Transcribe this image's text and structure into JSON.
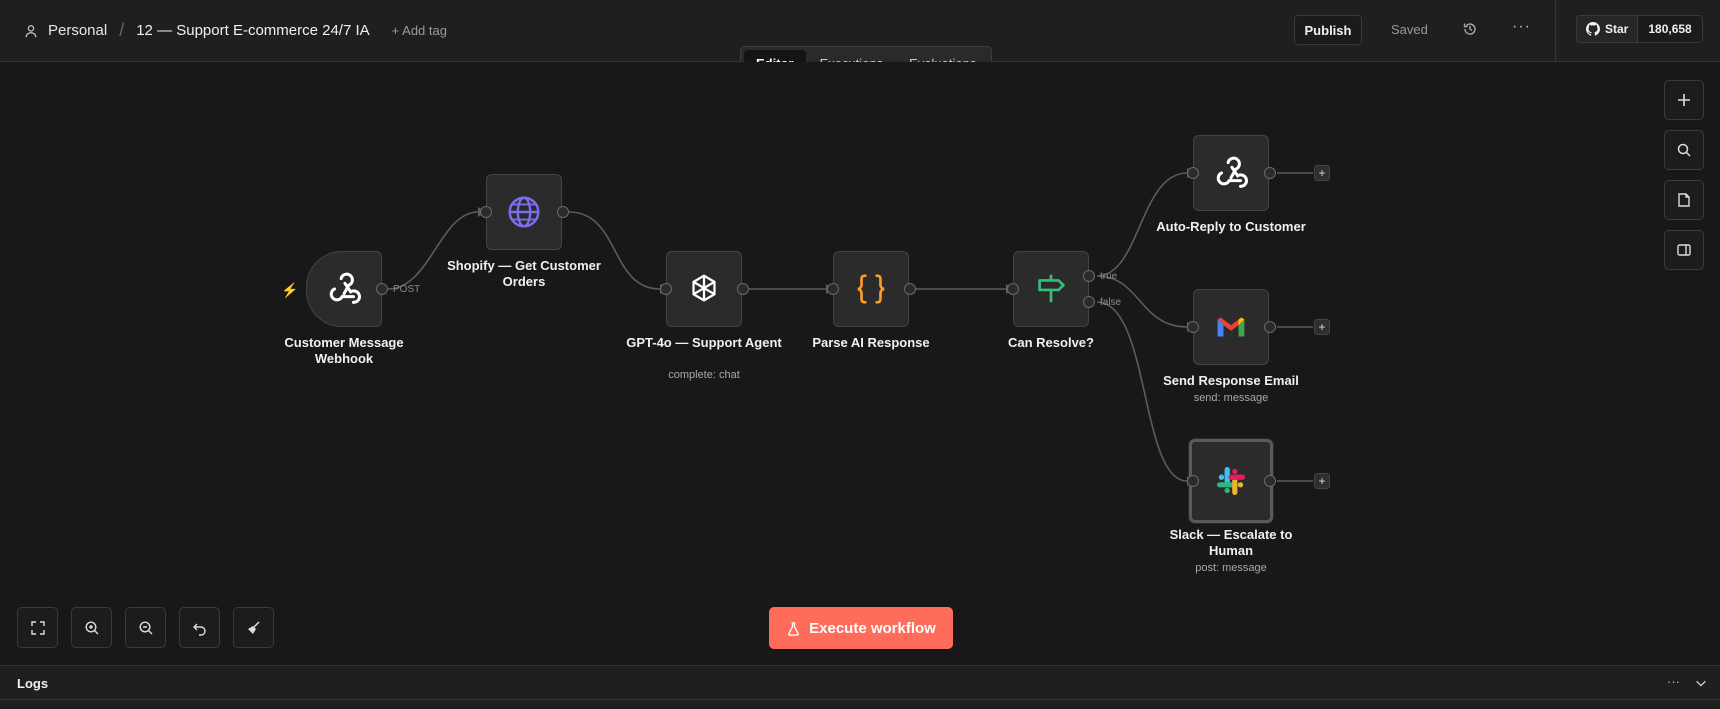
{
  "header": {
    "workspace": "Personal",
    "workflow_title": "12 — Support E-commerce 24/7 IA",
    "add_tag": "+ Add tag",
    "publish": "Publish",
    "status": "Saved",
    "github_star": "Star",
    "github_count": "180,658"
  },
  "tabs": [
    "Editor",
    "Executions",
    "Evaluations"
  ],
  "nodes": {
    "webhook": {
      "label": "Customer Message Webhook",
      "icon": "webhook-icon"
    },
    "shopify": {
      "label": "Shopify — Get Customer Orders",
      "icon": "globe-icon"
    },
    "gpt": {
      "label": "GPT-4o — Support Agent",
      "sub": "complete: chat",
      "icon": "openai-icon"
    },
    "parse": {
      "label": "Parse AI Response",
      "icon": "code-braces-icon"
    },
    "resolve": {
      "label": "Can Resolve?",
      "icon": "signpost-icon"
    },
    "autoreply": {
      "label": "Auto-Reply to Customer",
      "icon": "webhook-icon"
    },
    "email": {
      "label": "Send Response Email",
      "sub": "send: message",
      "icon": "gmail-icon"
    },
    "slack": {
      "label": "Slack — Escalate to Human",
      "sub": "post: message",
      "icon": "slack-icon"
    }
  },
  "edge_labels": {
    "post": "POST",
    "true": "true",
    "false": "false"
  },
  "execute_button": "Execute workflow",
  "logs": {
    "title": "Logs"
  },
  "colors": {
    "accent": "#ff6d5a",
    "globe": "#7b6cf0",
    "braces": "#ff9b26",
    "signpost": "#35c07a"
  }
}
